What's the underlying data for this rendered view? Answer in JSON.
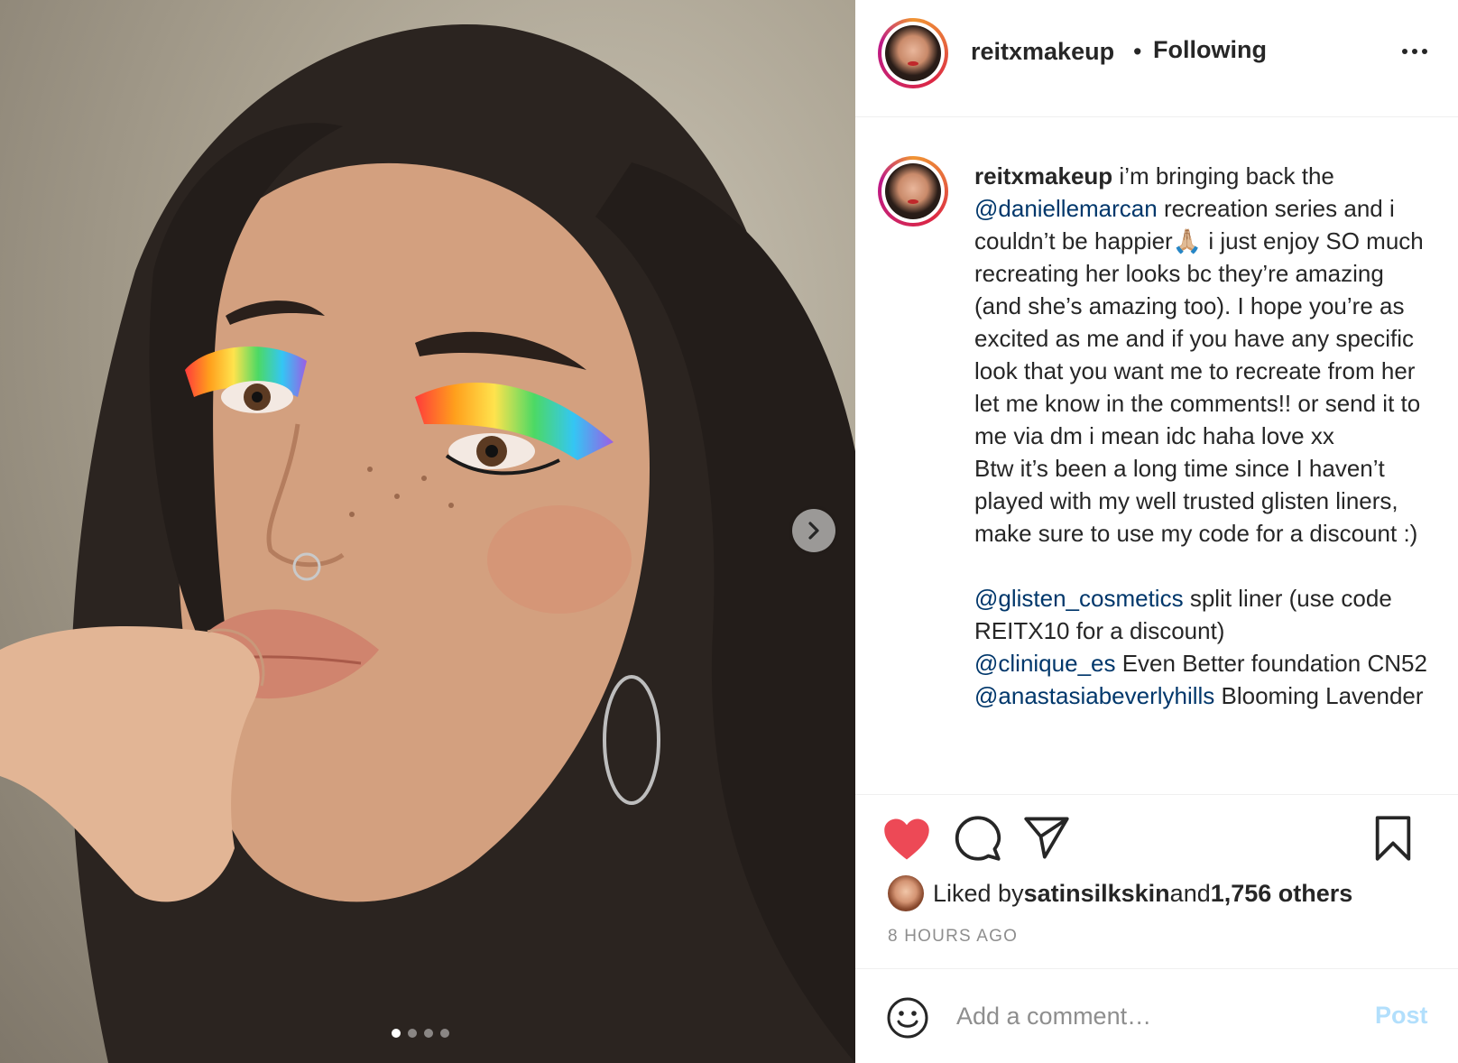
{
  "post": {
    "username": "reitxmakeup",
    "separator": "•",
    "follow_status": "Following",
    "more_icon": "more-horizontal-icon"
  },
  "caption": {
    "username": "reitxmakeup",
    "p1_a": " i’m bringing back the ",
    "mention1": "@daniellemarcan",
    "p1_b": " recreation series and i couldn’t be happier🙏🏼 i just enjoy SO much recreating her looks bc they’re amazing (and she’s amazing too). I hope you’re as excited as me and if you have any specific look that you want me to recreate from her let me know in the comments!! or send it to me via dm i mean idc haha love xx\nBtw it’s been a long time since I haven’t played with my well trusted glisten liners, make sure to use my code for a discount :)\n\n",
    "mention2": "@glisten_cosmetics",
    "p2": " split liner (use code REITX10 for a discount)\n",
    "mention3": "@clinique_es",
    "p3": " Even Better foundation CN52\n",
    "mention4": "@anastasiabeverlyhills",
    "p4": " Blooming Lavender"
  },
  "actions": {
    "like_icon": "heart-filled-icon",
    "comment_icon": "comment-bubble-icon",
    "share_icon": "paper-plane-icon",
    "save_icon": "bookmark-icon",
    "like_color": "#ed4956"
  },
  "likes": {
    "prefix": "Liked by ",
    "liker": "satinsilkskin",
    "middle": " and ",
    "others": "1,756 others"
  },
  "timestamp": "8 HOURS AGO",
  "comment": {
    "placeholder": "Add a comment…",
    "post_label": "Post",
    "emoji_icon": "smiley-icon",
    "post_color": "#b2dffc"
  },
  "carousel": {
    "next_icon": "chevron-right-icon",
    "total_slides": 4,
    "active_slide": 1
  }
}
